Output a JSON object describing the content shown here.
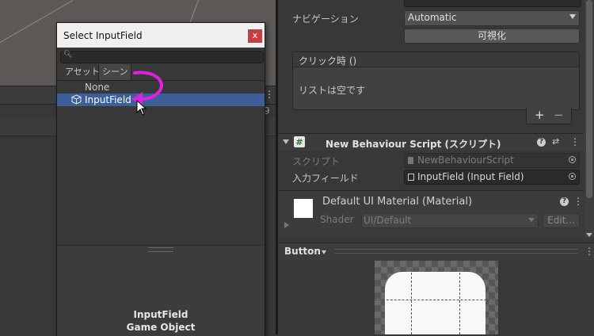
{
  "dialog": {
    "title": "Select InputField",
    "close": "x",
    "tabs": [
      "アセット",
      "シーン"
    ],
    "items": [
      {
        "label": "None",
        "selected": false
      },
      {
        "label": "InputField",
        "selected": true
      }
    ],
    "preview_name": "InputField",
    "preview_type": "Game Object"
  },
  "left": {
    "nine": "9",
    "dots": "⋮"
  },
  "inspector": {
    "navigation_label": "ナビゲーション",
    "navigation_value": "Automatic",
    "visualize_label": "可視化",
    "onclick_title": "クリック時 ()",
    "onclick_empty": "リストは空です",
    "plus": "+",
    "minus": "−",
    "component_title": "New Behaviour Script (スクリプト)",
    "script_label": "スクリプト",
    "script_value": "NewBehaviourScript",
    "input_label": "入力フィールド",
    "input_value": "InputField (Input Field)",
    "help": "?",
    "preset": "⇄",
    "menu": "⋮",
    "material_title": "Default UI Material (Material)",
    "shader_label": "Shader",
    "shader_value": "UI/Default",
    "edit_label": "Edit..."
  },
  "preview": {
    "title": "Button",
    "menu": "⋮"
  },
  "colors": {
    "selection": "#3d5e96",
    "annotation_arrow": "#e020e0",
    "close_button": "#c74040"
  }
}
